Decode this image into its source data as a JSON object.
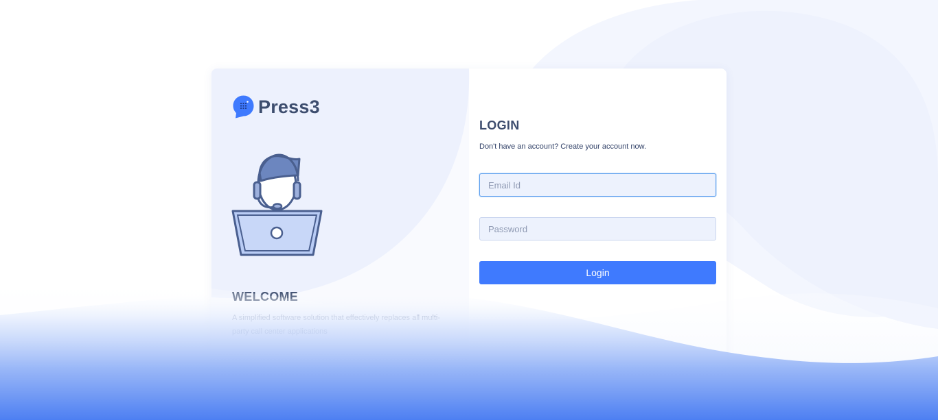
{
  "brand": {
    "name": "Press3",
    "logo_icon": "chat-bubble-dialpad-icon",
    "accent_color": "#3f7afe"
  },
  "welcome": {
    "title": "WELCOME",
    "description": "A simplified software solution that effectively replaces all multi-party call center applications",
    "illustration_icon": "support-agent-laptop-illustration"
  },
  "login": {
    "title": "LOGIN",
    "subtitle": "Don't have an account? Create your account now.",
    "email_placeholder": "Email Id",
    "password_placeholder": "Password",
    "submit_label": "Login"
  }
}
